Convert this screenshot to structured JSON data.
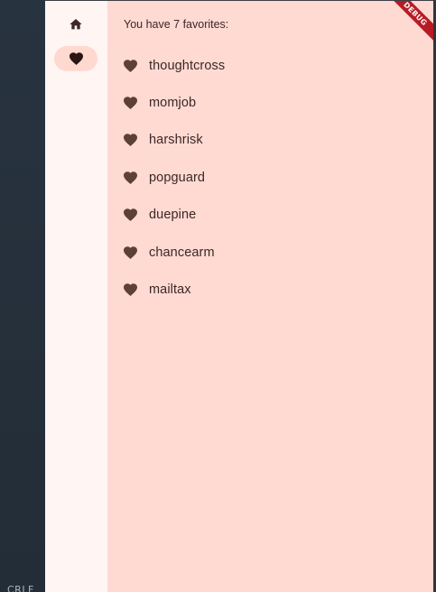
{
  "ide": {
    "corner_label": "CRLF"
  },
  "nav": {
    "items": [
      {
        "icon": "home-icon",
        "selected": false
      },
      {
        "icon": "favorite-icon",
        "selected": true
      }
    ]
  },
  "favorites": {
    "summary": "You have 7 favorites:",
    "items": [
      {
        "label": "thoughtcross"
      },
      {
        "label": "momjob"
      },
      {
        "label": "harshrisk"
      },
      {
        "label": "popguard"
      },
      {
        "label": "duepine"
      },
      {
        "label": "chancearm"
      },
      {
        "label": "mailtax"
      }
    ]
  },
  "banner": {
    "label": "DEBUG"
  },
  "colors": {
    "rail_background": "#fff5f3",
    "content_background": "#ffdad3",
    "selected_indicator": "#ffd9d0",
    "icon": "#5d4037",
    "text": "#3b2724",
    "debug_banner": "#b71c25"
  }
}
